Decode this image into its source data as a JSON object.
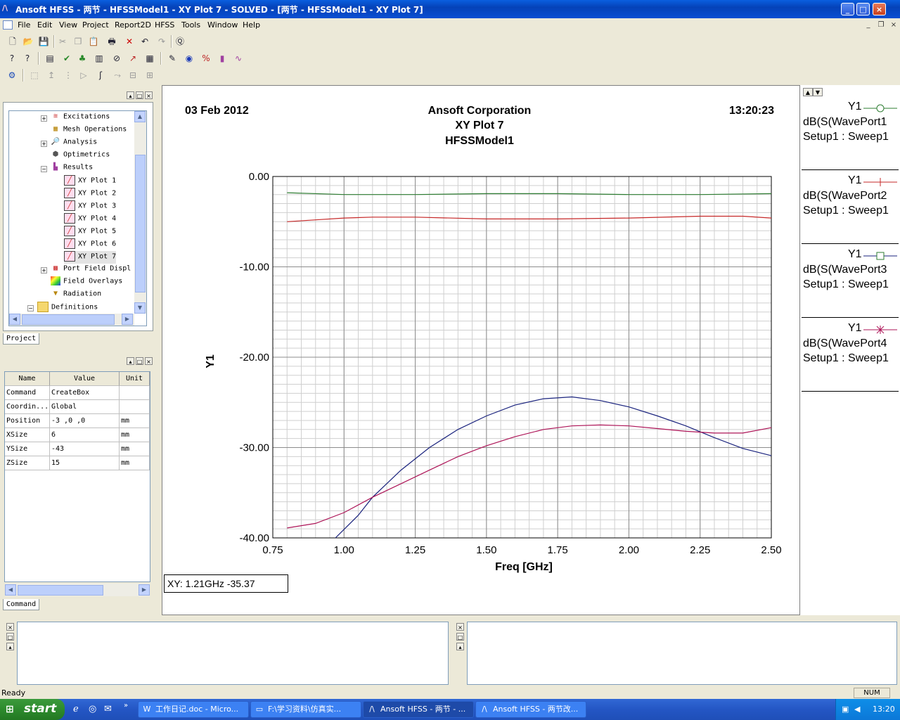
{
  "window": {
    "title": "Ansoft HFSS - 两节 - HFSSModel1 - XY Plot 7 - SOLVED - [两节 - HFSSModel1 - XY Plot 7]",
    "minimize": "_",
    "maximize": "□",
    "close": "×"
  },
  "menu": [
    "File",
    "Edit",
    "View",
    "Project",
    "Report2D",
    "HFSS",
    "Tools",
    "Window",
    "Help"
  ],
  "project_tree": {
    "nodes": [
      {
        "label": "Excitations",
        "icon": "excitations-icon"
      },
      {
        "label": "Mesh Operations",
        "icon": "mesh-icon"
      },
      {
        "label": "Analysis",
        "icon": "analysis-icon"
      },
      {
        "label": "Optimetrics",
        "icon": "optimetrics-icon"
      },
      {
        "label": "Results",
        "icon": "results-icon"
      },
      {
        "label": "XY Plot 1",
        "icon": "xy-plot-icon"
      },
      {
        "label": "XY Plot 2",
        "icon": "xy-plot-icon"
      },
      {
        "label": "XY Plot 3",
        "icon": "xy-plot-icon"
      },
      {
        "label": "XY Plot 4",
        "icon": "xy-plot-icon"
      },
      {
        "label": "XY Plot 5",
        "icon": "xy-plot-icon"
      },
      {
        "label": "XY Plot 6",
        "icon": "xy-plot-icon"
      },
      {
        "label": "XY Plot 7",
        "icon": "xy-plot-icon"
      },
      {
        "label": "Port Field Displ",
        "icon": "port-field-icon"
      },
      {
        "label": "Field Overlays",
        "icon": "field-overlays-icon"
      },
      {
        "label": "Radiation",
        "icon": "radiation-icon"
      },
      {
        "label": "Definitions",
        "icon": "folder-icon"
      }
    ],
    "tab_label": "Project"
  },
  "properties": {
    "headers": [
      "Name",
      "Value",
      "Unit"
    ],
    "rows": [
      [
        "Command",
        "CreateBox",
        ""
      ],
      [
        "Coordin...",
        "Global",
        ""
      ],
      [
        "Position",
        "-3 ,0 ,0",
        "mm"
      ],
      [
        "XSize",
        "6",
        "mm"
      ],
      [
        "YSize",
        "-43",
        "mm"
      ],
      [
        "ZSize",
        "15",
        "mm"
      ]
    ],
    "tab_label": "Command"
  },
  "plot_header": {
    "date": "03 Feb 2012",
    "company": "Ansoft Corporation",
    "plot_name": "XY Plot 7",
    "design": "HFSSModel1",
    "time": "13:20:23"
  },
  "readout": "XY: 1.21GHz -35.37",
  "chart_data": {
    "type": "line",
    "xlabel": "Freq [GHz]",
    "ylabel": "Y1",
    "xlim": [
      0.75,
      2.5
    ],
    "ylim": [
      -40,
      0
    ],
    "x_ticks": [
      "0.75",
      "1.00",
      "1.25",
      "1.50",
      "1.75",
      "2.00",
      "2.25",
      "2.50"
    ],
    "y_ticks": [
      "0.00",
      "-10.00",
      "-20.00",
      "-30.00",
      "-40.00"
    ],
    "grid": true,
    "series": [
      {
        "name": "dB(S(WavePort1",
        "color": "#2e7d32",
        "marker": "circle",
        "x": [
          0.8,
          1.0,
          1.25,
          1.5,
          1.75,
          2.0,
          2.25,
          2.5
        ],
        "y": [
          -1.8,
          -2.0,
          -2.0,
          -1.9,
          -1.9,
          -2.0,
          -2.0,
          -1.9
        ]
      },
      {
        "name": "dB(S(WavePort2",
        "color": "#c62828",
        "marker": "plus",
        "x": [
          0.8,
          0.9,
          1.0,
          1.1,
          1.25,
          1.5,
          1.75,
          2.0,
          2.25,
          2.4,
          2.5
        ],
        "y": [
          -5.0,
          -4.8,
          -4.6,
          -4.5,
          -4.5,
          -4.7,
          -4.7,
          -4.6,
          -4.4,
          -4.4,
          -4.6
        ]
      },
      {
        "name": "dB(S(WavePort3",
        "color": "#1a237e",
        "marker": "square",
        "x": [
          0.97,
          1.05,
          1.1,
          1.2,
          1.3,
          1.4,
          1.5,
          1.6,
          1.7,
          1.8,
          1.9,
          2.0,
          2.1,
          2.2,
          2.3,
          2.4,
          2.5
        ],
        "y": [
          -40.0,
          -37.5,
          -35.5,
          -32.5,
          -30.0,
          -28.0,
          -26.5,
          -25.3,
          -24.6,
          -24.4,
          -24.8,
          -25.5,
          -26.5,
          -27.6,
          -28.9,
          -30.1,
          -30.9
        ]
      },
      {
        "name": "dB(S(WavePort4",
        "color": "#ad1457",
        "marker": "star",
        "x": [
          0.8,
          0.9,
          1.0,
          1.1,
          1.2,
          1.3,
          1.4,
          1.5,
          1.6,
          1.7,
          1.8,
          1.9,
          2.0,
          2.1,
          2.2,
          2.3,
          2.4,
          2.5
        ],
        "y": [
          -38.9,
          -38.4,
          -37.2,
          -35.5,
          -34.0,
          -32.5,
          -31.0,
          -29.8,
          -28.8,
          -28.0,
          -27.6,
          -27.5,
          -27.6,
          -27.9,
          -28.2,
          -28.4,
          -28.4,
          -27.8
        ]
      }
    ]
  },
  "legend": {
    "items": [
      {
        "trace": "Y1",
        "expr": "dB(S(WavePort1",
        "setup": "Setup1 : Sweep1"
      },
      {
        "trace": "Y1",
        "expr": "dB(S(WavePort2",
        "setup": "Setup1 : Sweep1"
      },
      {
        "trace": "Y1",
        "expr": "dB(S(WavePort3",
        "setup": "Setup1 : Sweep1"
      },
      {
        "trace": "Y1",
        "expr": "dB(S(WavePort4",
        "setup": "Setup1 : Sweep1"
      }
    ]
  },
  "status": {
    "text": "Ready",
    "num": "NUM"
  },
  "taskbar": {
    "start": "start",
    "tasks": [
      "工作日记.doc - Micro...",
      "F:\\学习资料\\仿真实...",
      "Ansoft HFSS - 两节 - ...",
      "Ansoft HFSS - 两节改..."
    ],
    "clock": "13:20"
  }
}
